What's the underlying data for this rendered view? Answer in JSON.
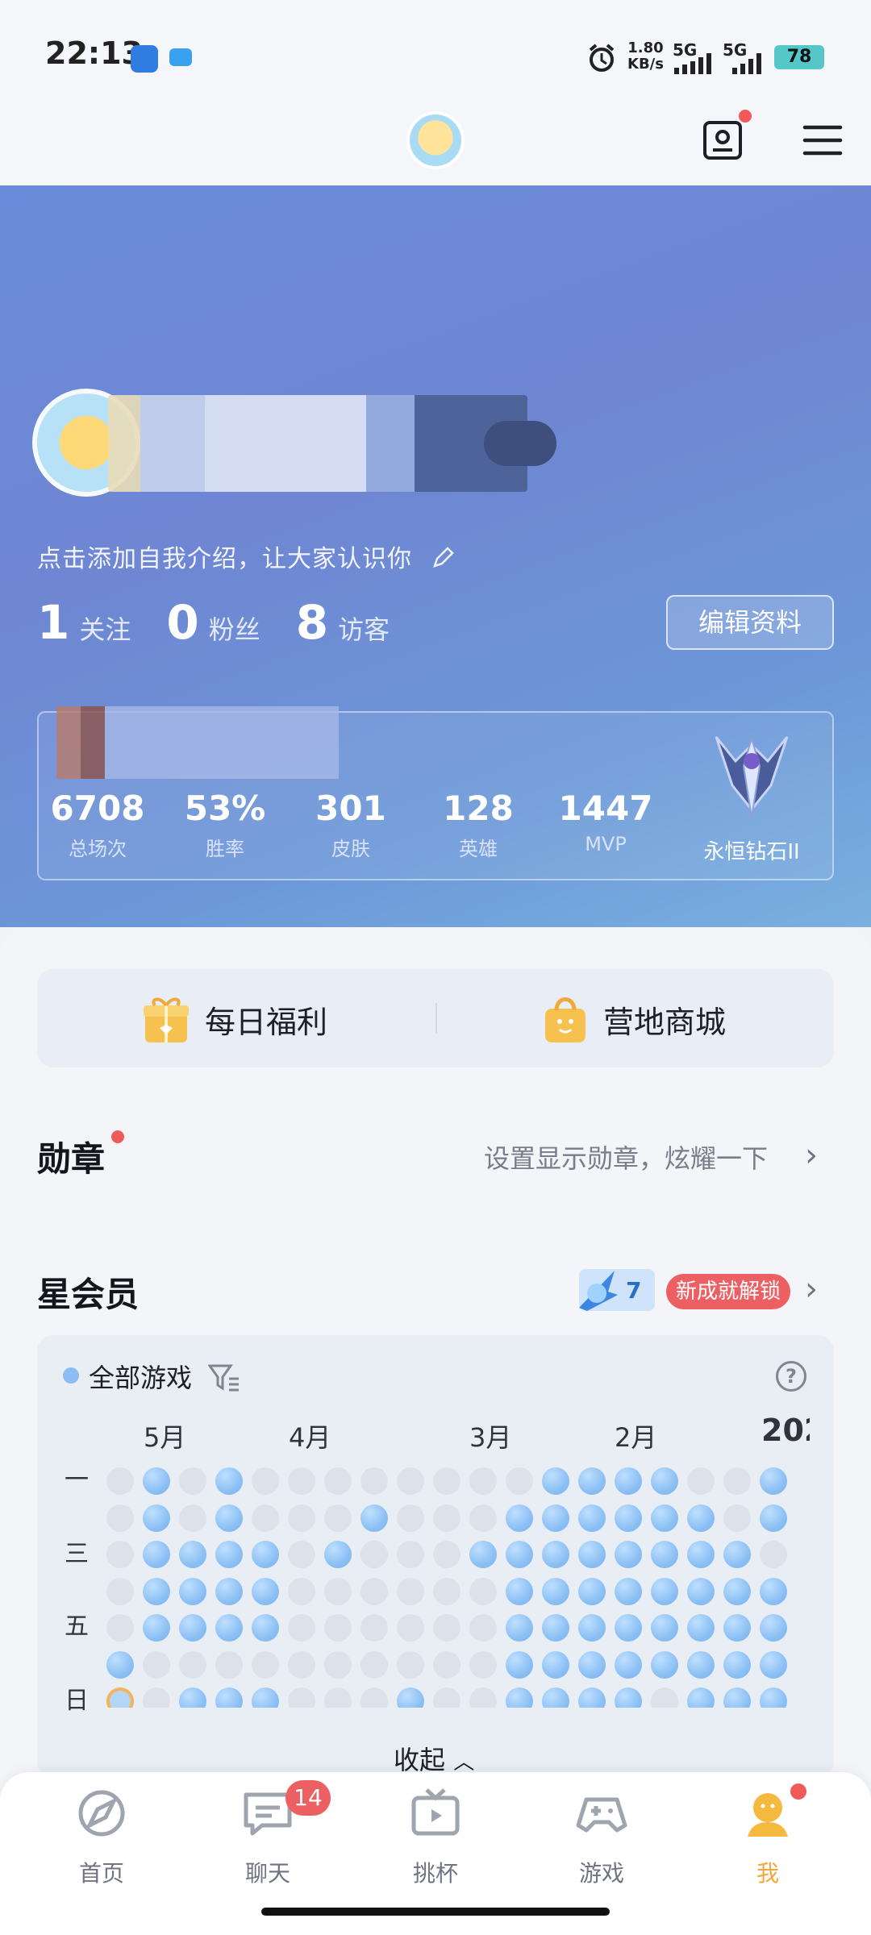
{
  "status_bar": {
    "time": "22:13",
    "net_speed": "1.80",
    "net_unit": "KB/s",
    "signal1": "5G",
    "signal2": "5G",
    "battery": "78"
  },
  "profile": {
    "intro": "点击添加自我介绍，让大家认识你",
    "following_count": "1",
    "following_label": "关注",
    "fans_count": "0",
    "fans_label": "粉丝",
    "visitors_count": "8",
    "visitors_label": "访客",
    "edit_label": "编辑资料"
  },
  "game_stats": {
    "items": [
      {
        "value": "6708",
        "label": "总场次"
      },
      {
        "value": "53%",
        "label": "胜率"
      },
      {
        "value": "301",
        "label": "皮肤"
      },
      {
        "value": "128",
        "label": "英雄"
      },
      {
        "value": "1447",
        "label": "MVP"
      }
    ],
    "rank": "永恒钻石II"
  },
  "quick": {
    "daily": "每日福利",
    "shop": "营地商城"
  },
  "medals": {
    "title": "勋章",
    "hint": "设置显示勋章，炫耀一下"
  },
  "vip": {
    "title": "星会员",
    "level": "7",
    "tag": "新成就解锁"
  },
  "calendar": {
    "filter": "全部游戏",
    "months": [
      "5月",
      "4月",
      "3月",
      "2月",
      "202"
    ],
    "weekdays": [
      "一",
      "三",
      "五",
      "日"
    ],
    "collapse": "收起"
  },
  "tabs": [
    {
      "label": "首页",
      "icon": "compass-icon"
    },
    {
      "label": "聊天",
      "icon": "chat-icon"
    },
    {
      "label": "挑杯",
      "icon": "tv-icon"
    },
    {
      "label": "游戏",
      "icon": "gamepad-icon"
    },
    {
      "label": "我",
      "icon": "profile-icon"
    }
  ],
  "chat_badge": "14",
  "colors": {
    "accent": "#f2a83a",
    "badge_red": "#ec5f63",
    "calendar_on": "#8cc0f4",
    "calendar_off": "#dde1ea",
    "hero_blue": "#6f86d3"
  }
}
